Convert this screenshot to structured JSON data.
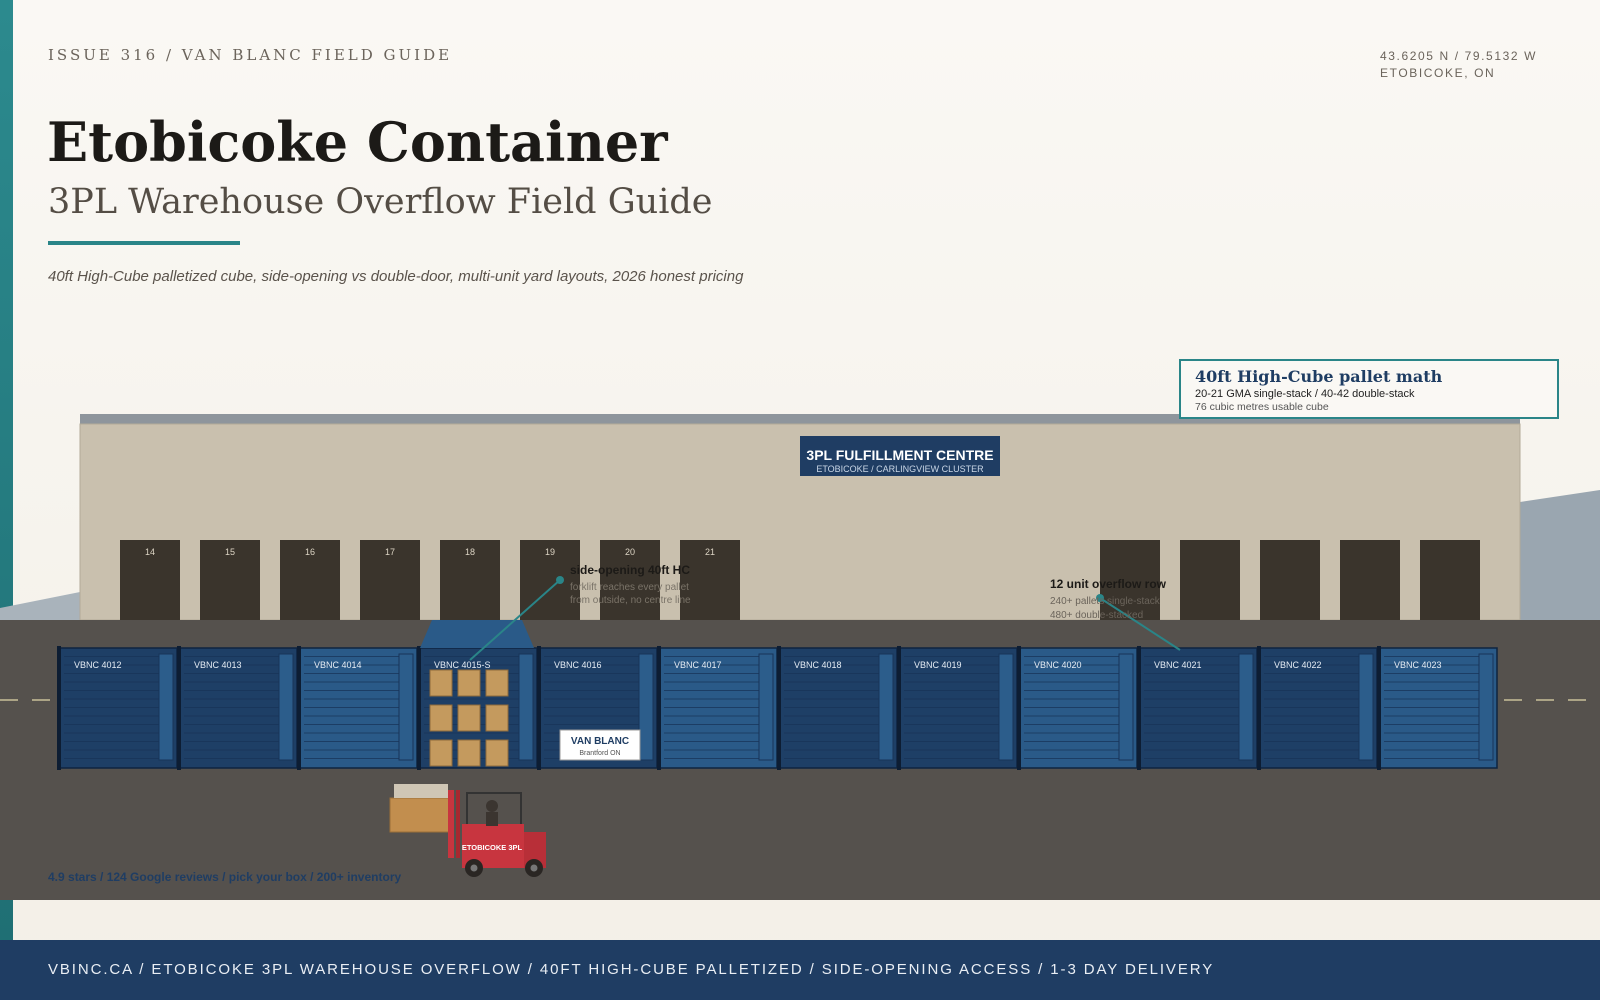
{
  "header": {
    "issue": "ISSUE 316 / VAN BLANC FIELD GUIDE",
    "coords_line1": "43.6205 N / 79.5132 W",
    "coords_line2": "ETOBICOKE, ON",
    "title": "Etobicoke Container",
    "subtitle": "3PL Warehouse Overflow Field Guide",
    "tagline": "40ft High-Cube palletized cube, side-opening vs double-door, multi-unit yard layouts, 2026 honest pricing"
  },
  "callout_box": {
    "title": "40ft High-Cube pallet math",
    "line1": "20-21 GMA single-stack / 40-42 double-stack",
    "line2": "76 cubic metres usable cube"
  },
  "warehouse": {
    "sign_title": "3PL FULFILLMENT CENTRE",
    "sign_sub": "ETOBICOKE / CARLINGVIEW CLUSTER",
    "dock_doors": [
      "14",
      "15",
      "16",
      "17",
      "18",
      "19",
      "20",
      "21",
      "",
      "",
      "",
      "",
      ""
    ]
  },
  "containers": [
    "VBNC 4012",
    "VBNC 4013",
    "VBNC 4014",
    "VBNC 4015-S",
    "VBNC 4016",
    "VBNC 4017",
    "VBNC 4018",
    "VBNC 4019",
    "VBNC 4020",
    "VBNC 4021",
    "VBNC 4022",
    "VBNC 4023"
  ],
  "annotations": {
    "side_title": "side-opening 40ft HC",
    "side_l1": "forklift reaches every pallet",
    "side_l2": "from outside, no centre line",
    "row_title": "12 unit overflow row",
    "row_l1": "240+ pallets single-stack",
    "row_l2": "480+ double-stacked"
  },
  "van_sign": {
    "name": "VAN BLANC",
    "place": "Brantford ON"
  },
  "forklift_label": "ETOBICOKE 3PL",
  "rating": "4.9 stars / 124 Google reviews / pick your box / 200+ inventory",
  "footer": "VBINC.CA / ETOBICOKE 3PL WAREHOUSE OVERFLOW / 40FT HIGH-CUBE PALLETIZED / SIDE-OPENING ACCESS / 1-3 DAY DELIVERY",
  "colors": {
    "accent": "#2a8588",
    "navy": "#1f3d63",
    "container_dark": "#1e3f66",
    "container_light": "#2a5a88",
    "forklift": "#c8353f"
  }
}
